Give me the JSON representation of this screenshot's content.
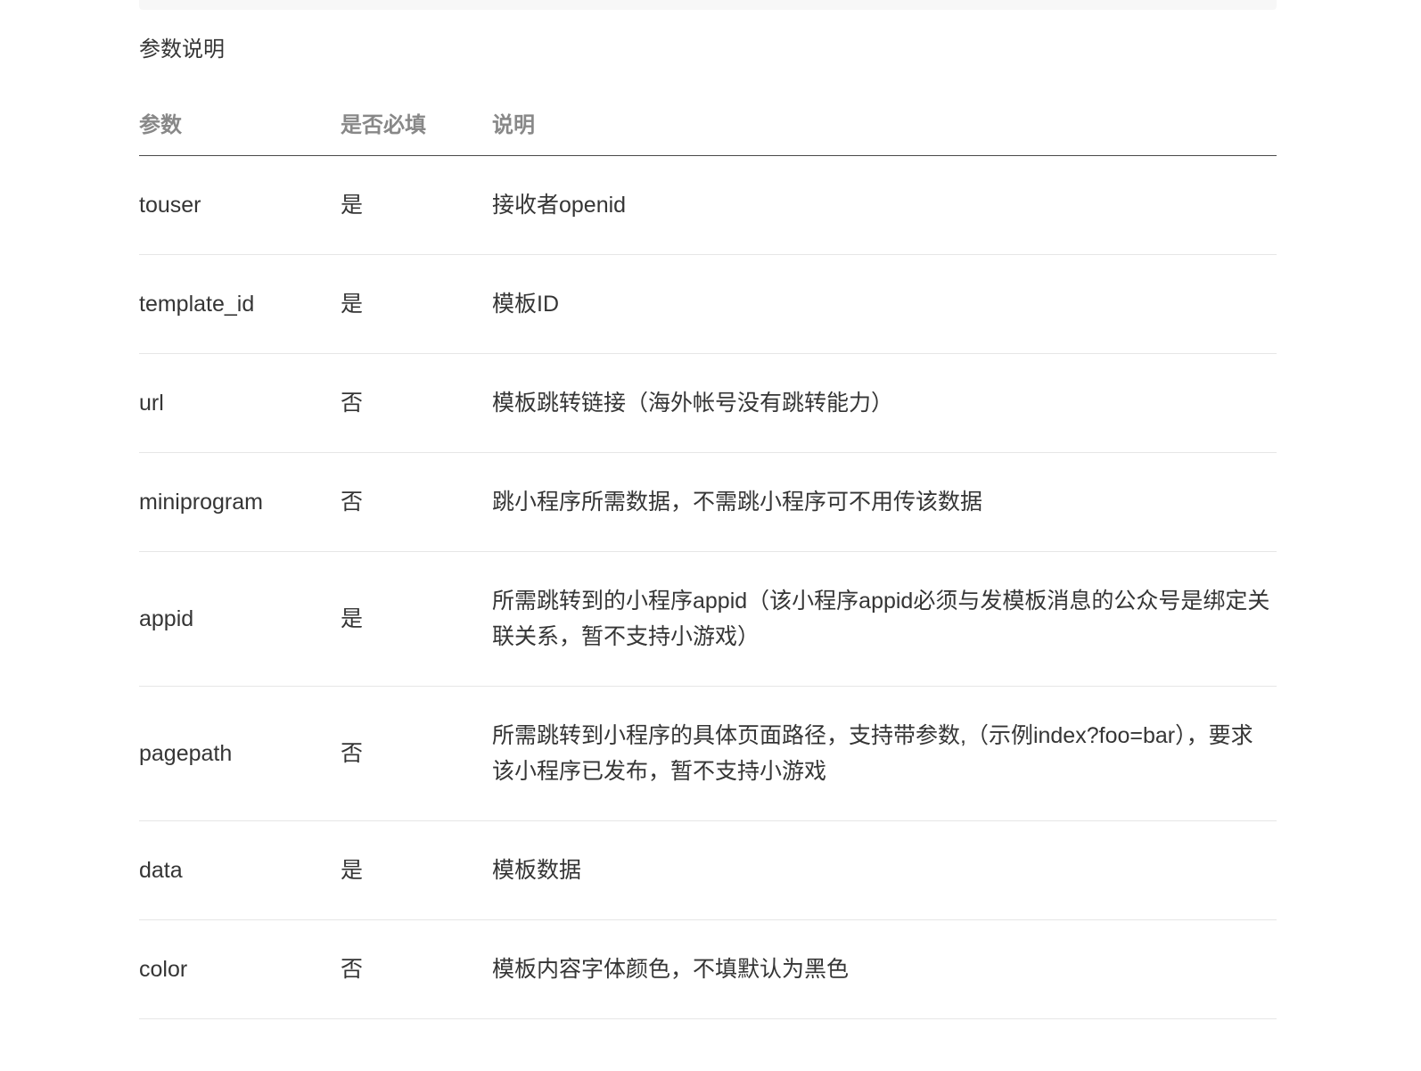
{
  "section_title": "参数说明",
  "table": {
    "headers": [
      "参数",
      "是否必填",
      "说明"
    ],
    "rows": [
      {
        "param": "touser",
        "required": "是",
        "desc": "接收者openid"
      },
      {
        "param": "template_id",
        "required": "是",
        "desc": "模板ID"
      },
      {
        "param": "url",
        "required": "否",
        "desc": "模板跳转链接（海外帐号没有跳转能力）"
      },
      {
        "param": "miniprogram",
        "required": "否",
        "desc": "跳小程序所需数据，不需跳小程序可不用传该数据"
      },
      {
        "param": "appid",
        "required": "是",
        "desc": "所需跳转到的小程序appid（该小程序appid必须与发模板消息的公众号是绑定关联关系，暂不支持小游戏）"
      },
      {
        "param": "pagepath",
        "required": "否",
        "desc": "所需跳转到小程序的具体页面路径，支持带参数,（示例index?foo=bar），要求该小程序已发布，暂不支持小游戏"
      },
      {
        "param": "data",
        "required": "是",
        "desc": "模板数据"
      },
      {
        "param": "color",
        "required": "否",
        "desc": "模板内容字体颜色，不填默认为黑色"
      }
    ]
  }
}
